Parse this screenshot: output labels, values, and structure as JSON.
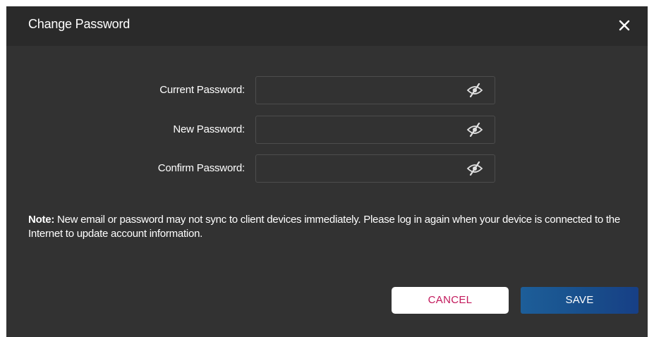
{
  "dialog": {
    "title": "Change Password",
    "close_icon": "close-icon"
  },
  "fields": [
    {
      "label": "Current Password:",
      "value": "",
      "toggle_icon": "eye-slash-icon"
    },
    {
      "label": "New Password:",
      "value": "",
      "toggle_icon": "eye-slash-icon"
    },
    {
      "label": "Confirm Password:",
      "value": "",
      "toggle_icon": "eye-slash-icon"
    }
  ],
  "note": {
    "prefix": "Note:",
    "text": " New email or password may not sync to client devices immediately. Please log in again when your device is connected to the Internet to update account information."
  },
  "buttons": {
    "cancel_label": "CANCEL",
    "save_label": "SAVE"
  },
  "colors": {
    "dialog_background": "#323232",
    "header_background": "#2a2a2a",
    "cancel_text": "#c2185b",
    "save_background": "#1d5e99"
  }
}
